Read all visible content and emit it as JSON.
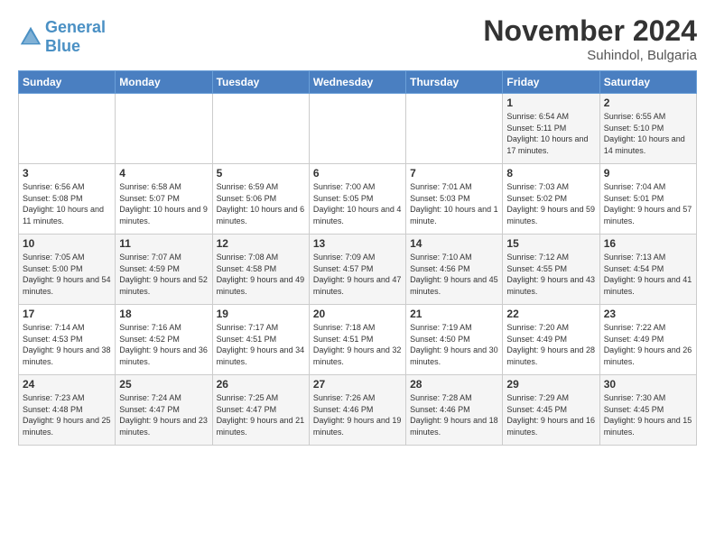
{
  "header": {
    "logo_line1": "General",
    "logo_line2": "Blue",
    "month": "November 2024",
    "location": "Suhindol, Bulgaria"
  },
  "days_of_week": [
    "Sunday",
    "Monday",
    "Tuesday",
    "Wednesday",
    "Thursday",
    "Friday",
    "Saturday"
  ],
  "weeks": [
    [
      {
        "day": "",
        "info": ""
      },
      {
        "day": "",
        "info": ""
      },
      {
        "day": "",
        "info": ""
      },
      {
        "day": "",
        "info": ""
      },
      {
        "day": "",
        "info": ""
      },
      {
        "day": "1",
        "info": "Sunrise: 6:54 AM\nSunset: 5:11 PM\nDaylight: 10 hours and 17 minutes."
      },
      {
        "day": "2",
        "info": "Sunrise: 6:55 AM\nSunset: 5:10 PM\nDaylight: 10 hours and 14 minutes."
      }
    ],
    [
      {
        "day": "3",
        "info": "Sunrise: 6:56 AM\nSunset: 5:08 PM\nDaylight: 10 hours and 11 minutes."
      },
      {
        "day": "4",
        "info": "Sunrise: 6:58 AM\nSunset: 5:07 PM\nDaylight: 10 hours and 9 minutes."
      },
      {
        "day": "5",
        "info": "Sunrise: 6:59 AM\nSunset: 5:06 PM\nDaylight: 10 hours and 6 minutes."
      },
      {
        "day": "6",
        "info": "Sunrise: 7:00 AM\nSunset: 5:05 PM\nDaylight: 10 hours and 4 minutes."
      },
      {
        "day": "7",
        "info": "Sunrise: 7:01 AM\nSunset: 5:03 PM\nDaylight: 10 hours and 1 minute."
      },
      {
        "day": "8",
        "info": "Sunrise: 7:03 AM\nSunset: 5:02 PM\nDaylight: 9 hours and 59 minutes."
      },
      {
        "day": "9",
        "info": "Sunrise: 7:04 AM\nSunset: 5:01 PM\nDaylight: 9 hours and 57 minutes."
      }
    ],
    [
      {
        "day": "10",
        "info": "Sunrise: 7:05 AM\nSunset: 5:00 PM\nDaylight: 9 hours and 54 minutes."
      },
      {
        "day": "11",
        "info": "Sunrise: 7:07 AM\nSunset: 4:59 PM\nDaylight: 9 hours and 52 minutes."
      },
      {
        "day": "12",
        "info": "Sunrise: 7:08 AM\nSunset: 4:58 PM\nDaylight: 9 hours and 49 minutes."
      },
      {
        "day": "13",
        "info": "Sunrise: 7:09 AM\nSunset: 4:57 PM\nDaylight: 9 hours and 47 minutes."
      },
      {
        "day": "14",
        "info": "Sunrise: 7:10 AM\nSunset: 4:56 PM\nDaylight: 9 hours and 45 minutes."
      },
      {
        "day": "15",
        "info": "Sunrise: 7:12 AM\nSunset: 4:55 PM\nDaylight: 9 hours and 43 minutes."
      },
      {
        "day": "16",
        "info": "Sunrise: 7:13 AM\nSunset: 4:54 PM\nDaylight: 9 hours and 41 minutes."
      }
    ],
    [
      {
        "day": "17",
        "info": "Sunrise: 7:14 AM\nSunset: 4:53 PM\nDaylight: 9 hours and 38 minutes."
      },
      {
        "day": "18",
        "info": "Sunrise: 7:16 AM\nSunset: 4:52 PM\nDaylight: 9 hours and 36 minutes."
      },
      {
        "day": "19",
        "info": "Sunrise: 7:17 AM\nSunset: 4:51 PM\nDaylight: 9 hours and 34 minutes."
      },
      {
        "day": "20",
        "info": "Sunrise: 7:18 AM\nSunset: 4:51 PM\nDaylight: 9 hours and 32 minutes."
      },
      {
        "day": "21",
        "info": "Sunrise: 7:19 AM\nSunset: 4:50 PM\nDaylight: 9 hours and 30 minutes."
      },
      {
        "day": "22",
        "info": "Sunrise: 7:20 AM\nSunset: 4:49 PM\nDaylight: 9 hours and 28 minutes."
      },
      {
        "day": "23",
        "info": "Sunrise: 7:22 AM\nSunset: 4:49 PM\nDaylight: 9 hours and 26 minutes."
      }
    ],
    [
      {
        "day": "24",
        "info": "Sunrise: 7:23 AM\nSunset: 4:48 PM\nDaylight: 9 hours and 25 minutes."
      },
      {
        "day": "25",
        "info": "Sunrise: 7:24 AM\nSunset: 4:47 PM\nDaylight: 9 hours and 23 minutes."
      },
      {
        "day": "26",
        "info": "Sunrise: 7:25 AM\nSunset: 4:47 PM\nDaylight: 9 hours and 21 minutes."
      },
      {
        "day": "27",
        "info": "Sunrise: 7:26 AM\nSunset: 4:46 PM\nDaylight: 9 hours and 19 minutes."
      },
      {
        "day": "28",
        "info": "Sunrise: 7:28 AM\nSunset: 4:46 PM\nDaylight: 9 hours and 18 minutes."
      },
      {
        "day": "29",
        "info": "Sunrise: 7:29 AM\nSunset: 4:45 PM\nDaylight: 9 hours and 16 minutes."
      },
      {
        "day": "30",
        "info": "Sunrise: 7:30 AM\nSunset: 4:45 PM\nDaylight: 9 hours and 15 minutes."
      }
    ]
  ]
}
